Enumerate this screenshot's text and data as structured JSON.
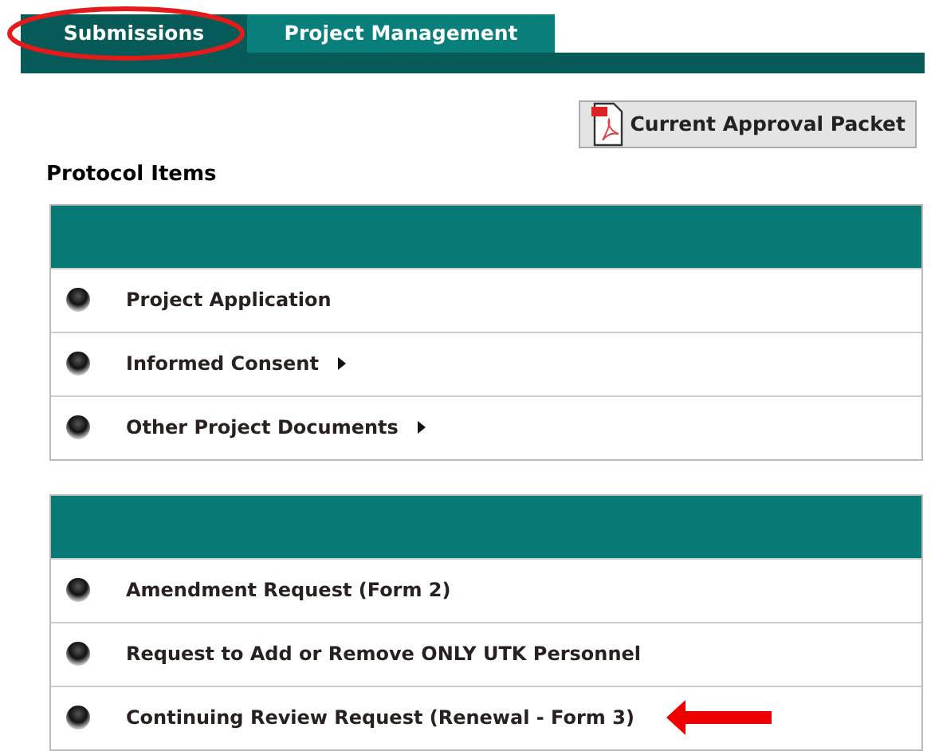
{
  "tabs": [
    {
      "label": "Submissions",
      "selected": true,
      "circled": true
    },
    {
      "label": "Project Management",
      "selected": false,
      "circled": false
    }
  ],
  "packet_button": {
    "label": "Current Approval Packet"
  },
  "section_title": "Protocol Items",
  "panels": [
    {
      "items": [
        {
          "label": "Project Application",
          "has_submenu": false,
          "arrow": false
        },
        {
          "label": "Informed Consent",
          "has_submenu": true,
          "arrow": false
        },
        {
          "label": "Other Project Documents",
          "has_submenu": true,
          "arrow": false
        }
      ]
    },
    {
      "items": [
        {
          "label": "Amendment Request (Form 2)",
          "has_submenu": false,
          "arrow": false
        },
        {
          "label": "Request to Add or Remove ONLY UTK Personnel",
          "has_submenu": false,
          "arrow": false
        },
        {
          "label": "Continuing Review Request (Renewal - Form 3)",
          "has_submenu": false,
          "arrow": true
        }
      ]
    }
  ]
}
